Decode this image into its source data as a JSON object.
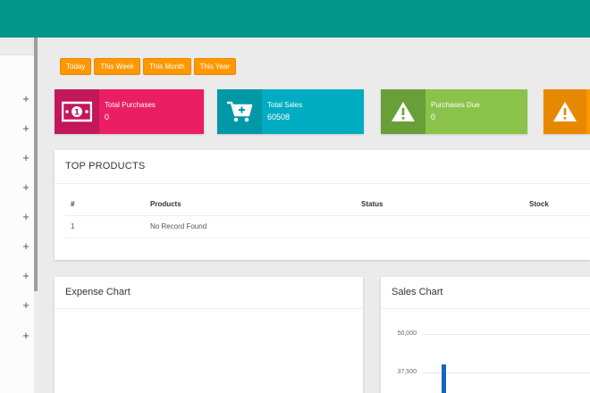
{
  "filters": [
    "Today",
    "This Week",
    "This Month",
    "This Year"
  ],
  "stats": [
    {
      "label": "Total Purchases",
      "value": "0",
      "icon": "money-icon",
      "color": "#e91e63",
      "dark": "#c2185b"
    },
    {
      "label": "Total Sales",
      "value": "60508",
      "icon": "cart-plus-icon",
      "color": "#00acc1",
      "dark": "#0097a7"
    },
    {
      "label": "Purchases Due",
      "value": "0",
      "icon": "warning-icon",
      "color": "#8bc34a",
      "dark": "#689f38"
    },
    {
      "label": "",
      "value": "",
      "icon": "warning-icon",
      "color": "#ff9800",
      "dark": "#e68900"
    }
  ],
  "top_products": {
    "title": "TOP PRODUCTS",
    "columns": [
      "#",
      "Products",
      "Status",
      "Stock"
    ],
    "rows": [
      [
        "1",
        "No Record Found",
        "",
        ""
      ]
    ]
  },
  "expense_chart": {
    "title": "Expense Chart"
  },
  "sales_chart": {
    "title": "Sales Chart"
  },
  "chart_data": {
    "type": "bar",
    "ylim": [
      0,
      50000
    ],
    "yticks": [
      "50,000",
      "37,500"
    ],
    "values": [
      40000
    ]
  }
}
